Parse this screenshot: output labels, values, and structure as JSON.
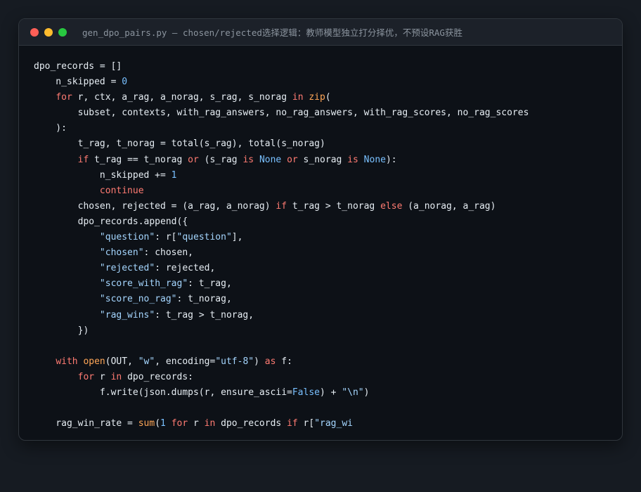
{
  "window": {
    "title": "gen_dpo_pairs.py — chosen/rejected选择逻辑：教师模型独立打分择优，不预设RAG获胜",
    "controls": [
      {
        "name": "close",
        "color": "#ff5f57"
      },
      {
        "name": "minimize",
        "color": "#febc2e"
      },
      {
        "name": "maximize",
        "color": "#28c840"
      }
    ]
  },
  "colors": {
    "keyword": "#ff7b72",
    "builtin": "#ffa657",
    "string": "#a5d6ff",
    "number": "#79c0ff",
    "plain": "#e6edf3"
  },
  "code": {
    "language": "python",
    "lines": [
      [
        [
          "plain",
          "dpo_records = []"
        ]
      ],
      [
        [
          "plain",
          "    n_skipped = "
        ],
        [
          "num",
          "0"
        ]
      ],
      [
        [
          "plain",
          "    "
        ],
        [
          "kw",
          "for"
        ],
        [
          "plain",
          " r, ctx, a_rag, a_norag, s_rag, s_norag "
        ],
        [
          "kw",
          "in"
        ],
        [
          "plain",
          " "
        ],
        [
          "bi",
          "zip"
        ],
        [
          "plain",
          "("
        ]
      ],
      [
        [
          "plain",
          "        subset, contexts, with_rag_answers, no_rag_answers, with_rag_scores, no_rag_scores"
        ]
      ],
      [
        [
          "plain",
          "    ):"
        ]
      ],
      [
        [
          "plain",
          "        t_rag, t_norag = total(s_rag), total(s_norag)"
        ]
      ],
      [
        [
          "plain",
          "        "
        ],
        [
          "kw",
          "if"
        ],
        [
          "plain",
          " t_rag == t_norag "
        ],
        [
          "kw",
          "or"
        ],
        [
          "plain",
          " (s_rag "
        ],
        [
          "kw",
          "is"
        ],
        [
          "plain",
          " "
        ],
        [
          "const",
          "None"
        ],
        [
          "plain",
          " "
        ],
        [
          "kw",
          "or"
        ],
        [
          "plain",
          " s_norag "
        ],
        [
          "kw",
          "is"
        ],
        [
          "plain",
          " "
        ],
        [
          "const",
          "None"
        ],
        [
          "plain",
          "):"
        ]
      ],
      [
        [
          "plain",
          "            n_skipped += "
        ],
        [
          "num",
          "1"
        ]
      ],
      [
        [
          "plain",
          "            "
        ],
        [
          "kw",
          "continue"
        ]
      ],
      [
        [
          "plain",
          "        chosen, rejected = (a_rag, a_norag) "
        ],
        [
          "kw",
          "if"
        ],
        [
          "plain",
          " t_rag > t_norag "
        ],
        [
          "kw",
          "else"
        ],
        [
          "plain",
          " (a_norag, a_rag)"
        ]
      ],
      [
        [
          "plain",
          "        dpo_records.append({"
        ]
      ],
      [
        [
          "plain",
          "            "
        ],
        [
          "str",
          "\"question\""
        ],
        [
          "plain",
          ": r["
        ],
        [
          "str",
          "\"question\""
        ],
        [
          "plain",
          "],"
        ]
      ],
      [
        [
          "plain",
          "            "
        ],
        [
          "str",
          "\"chosen\""
        ],
        [
          "plain",
          ": chosen,"
        ]
      ],
      [
        [
          "plain",
          "            "
        ],
        [
          "str",
          "\"rejected\""
        ],
        [
          "plain",
          ": rejected,"
        ]
      ],
      [
        [
          "plain",
          "            "
        ],
        [
          "str",
          "\"score_with_rag\""
        ],
        [
          "plain",
          ": t_rag,"
        ]
      ],
      [
        [
          "plain",
          "            "
        ],
        [
          "str",
          "\"score_no_rag\""
        ],
        [
          "plain",
          ": t_norag,"
        ]
      ],
      [
        [
          "plain",
          "            "
        ],
        [
          "str",
          "\"rag_wins\""
        ],
        [
          "plain",
          ": t_rag > t_norag,"
        ]
      ],
      [
        [
          "plain",
          "        })"
        ]
      ],
      [
        [
          "plain",
          ""
        ]
      ],
      [
        [
          "plain",
          "    "
        ],
        [
          "kw",
          "with"
        ],
        [
          "plain",
          " "
        ],
        [
          "bi",
          "open"
        ],
        [
          "plain",
          "(OUT, "
        ],
        [
          "str",
          "\"w\""
        ],
        [
          "plain",
          ", encoding="
        ],
        [
          "str",
          "\"utf-8\""
        ],
        [
          "plain",
          ") "
        ],
        [
          "kw",
          "as"
        ],
        [
          "plain",
          " f:"
        ]
      ],
      [
        [
          "plain",
          "        "
        ],
        [
          "kw",
          "for"
        ],
        [
          "plain",
          " r "
        ],
        [
          "kw",
          "in"
        ],
        [
          "plain",
          " dpo_records:"
        ]
      ],
      [
        [
          "plain",
          "            f.write(json.dumps(r, ensure_ascii="
        ],
        [
          "const",
          "False"
        ],
        [
          "plain",
          ") + "
        ],
        [
          "str",
          "\"\\n\""
        ],
        [
          "plain",
          ")"
        ]
      ],
      [
        [
          "plain",
          ""
        ]
      ],
      [
        [
          "plain",
          "    rag_win_rate = "
        ],
        [
          "bi",
          "sum"
        ],
        [
          "plain",
          "("
        ],
        [
          "num",
          "1"
        ],
        [
          "plain",
          " "
        ],
        [
          "kw",
          "for"
        ],
        [
          "plain",
          " r "
        ],
        [
          "kw",
          "in"
        ],
        [
          "plain",
          " dpo_records "
        ],
        [
          "kw",
          "if"
        ],
        [
          "plain",
          " r["
        ],
        [
          "str",
          "\"rag_wi"
        ]
      ]
    ]
  }
}
